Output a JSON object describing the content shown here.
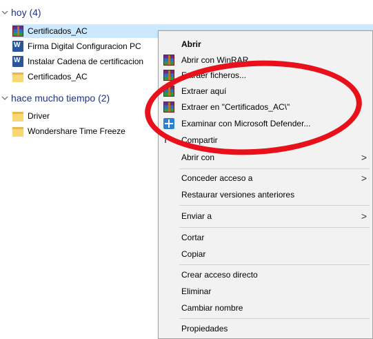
{
  "groups": [
    {
      "label": "hoy (4)"
    },
    {
      "label": "hace mucho tiempo (2)"
    }
  ],
  "files_today": [
    {
      "name": "Certificados_AC",
      "icon": "winrar-archive-icon"
    },
    {
      "name": "Firma Digital Configuracion PC",
      "icon": "word-document-icon"
    },
    {
      "name": "Instalar Cadena de certificacion",
      "icon": "word-document-icon"
    },
    {
      "name": "Certificados_AC",
      "icon": "folder-icon"
    }
  ],
  "files_old": [
    {
      "name": "Driver",
      "icon": "folder-icon"
    },
    {
      "name": "Wondershare Time Freeze",
      "icon": "folder-icon"
    }
  ],
  "context_menu": {
    "items": [
      {
        "label": "Abrir"
      },
      {
        "label": "Abrir con WinRAR"
      },
      {
        "label": "Extraer ficheros..."
      },
      {
        "label": "Extraer aquí"
      },
      {
        "label": "Extraer en \"Certificados_AC\\\""
      },
      {
        "label": "Examinar con Microsoft Defender..."
      },
      {
        "label": "Compartir"
      },
      {
        "label": "Abrir con"
      },
      {
        "label": "Conceder acceso a"
      },
      {
        "label": "Restaurar versiones anteriores"
      },
      {
        "label": "Enviar a"
      },
      {
        "label": "Cortar"
      },
      {
        "label": "Copiar"
      },
      {
        "label": "Crear acceso directo"
      },
      {
        "label": "Eliminar"
      },
      {
        "label": "Cambiar nombre"
      },
      {
        "label": "Propiedades"
      }
    ],
    "submenu_glyph": ">"
  },
  "colors": {
    "selection": "#cce8ff",
    "group_header": "#1e3287",
    "annotation_circle": "#e8101a",
    "menu_bg": "#f2f2f2"
  }
}
